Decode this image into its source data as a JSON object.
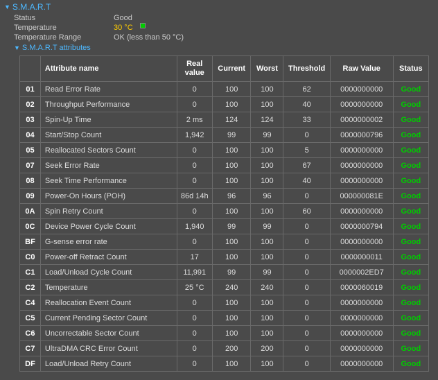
{
  "section": {
    "title": "S.M.A.R.T",
    "sub_title": "S.M.A.R.T attributes"
  },
  "info": {
    "status_label": "Status",
    "status_value": "Good",
    "temp_label": "Temperature",
    "temp_value": "30 °C",
    "range_label": "Temperature Range",
    "range_value": "OK (less than 50 °C)"
  },
  "headers": {
    "id": "",
    "name": "Attribute name",
    "real": "Real value",
    "current": "Current",
    "worst": "Worst",
    "threshold": "Threshold",
    "raw": "Raw Value",
    "status": "Status"
  },
  "rows": [
    {
      "id": "01",
      "name": "Read Error Rate",
      "real": "0",
      "current": "100",
      "worst": "100",
      "threshold": "62",
      "raw": "0000000000",
      "status": "Good"
    },
    {
      "id": "02",
      "name": "Throughput Performance",
      "real": "0",
      "current": "100",
      "worst": "100",
      "threshold": "40",
      "raw": "0000000000",
      "status": "Good"
    },
    {
      "id": "03",
      "name": "Spin-Up Time",
      "real": "2 ms",
      "current": "124",
      "worst": "124",
      "threshold": "33",
      "raw": "0000000002",
      "status": "Good"
    },
    {
      "id": "04",
      "name": "Start/Stop Count",
      "real": "1,942",
      "current": "99",
      "worst": "99",
      "threshold": "0",
      "raw": "0000000796",
      "status": "Good"
    },
    {
      "id": "05",
      "name": "Reallocated Sectors Count",
      "real": "0",
      "current": "100",
      "worst": "100",
      "threshold": "5",
      "raw": "0000000000",
      "status": "Good"
    },
    {
      "id": "07",
      "name": "Seek Error Rate",
      "real": "0",
      "current": "100",
      "worst": "100",
      "threshold": "67",
      "raw": "0000000000",
      "status": "Good"
    },
    {
      "id": "08",
      "name": "Seek Time Performance",
      "real": "0",
      "current": "100",
      "worst": "100",
      "threshold": "40",
      "raw": "0000000000",
      "status": "Good"
    },
    {
      "id": "09",
      "name": "Power-On Hours (POH)",
      "real": "86d 14h",
      "current": "96",
      "worst": "96",
      "threshold": "0",
      "raw": "000000081E",
      "status": "Good"
    },
    {
      "id": "0A",
      "name": "Spin Retry Count",
      "real": "0",
      "current": "100",
      "worst": "100",
      "threshold": "60",
      "raw": "0000000000",
      "status": "Good"
    },
    {
      "id": "0C",
      "name": "Device Power Cycle Count",
      "real": "1,940",
      "current": "99",
      "worst": "99",
      "threshold": "0",
      "raw": "0000000794",
      "status": "Good"
    },
    {
      "id": "BF",
      "name": "G-sense error rate",
      "real": "0",
      "current": "100",
      "worst": "100",
      "threshold": "0",
      "raw": "0000000000",
      "status": "Good"
    },
    {
      "id": "C0",
      "name": "Power-off Retract Count",
      "real": "17",
      "current": "100",
      "worst": "100",
      "threshold": "0",
      "raw": "0000000011",
      "status": "Good"
    },
    {
      "id": "C1",
      "name": "Load/Unload Cycle Count",
      "real": "11,991",
      "current": "99",
      "worst": "99",
      "threshold": "0",
      "raw": "0000002ED7",
      "status": "Good"
    },
    {
      "id": "C2",
      "name": "Temperature",
      "real": "25 °C",
      "current": "240",
      "worst": "240",
      "threshold": "0",
      "raw": "0000060019",
      "status": "Good"
    },
    {
      "id": "C4",
      "name": "Reallocation Event Count",
      "real": "0",
      "current": "100",
      "worst": "100",
      "threshold": "0",
      "raw": "0000000000",
      "status": "Good"
    },
    {
      "id": "C5",
      "name": "Current Pending Sector Count",
      "real": "0",
      "current": "100",
      "worst": "100",
      "threshold": "0",
      "raw": "0000000000",
      "status": "Good"
    },
    {
      "id": "C6",
      "name": "Uncorrectable Sector Count",
      "real": "0",
      "current": "100",
      "worst": "100",
      "threshold": "0",
      "raw": "0000000000",
      "status": "Good"
    },
    {
      "id": "C7",
      "name": "UltraDMA CRC Error Count",
      "real": "0",
      "current": "200",
      "worst": "200",
      "threshold": "0",
      "raw": "0000000000",
      "status": "Good"
    },
    {
      "id": "DF",
      "name": "Load/Unload Retry Count",
      "real": "0",
      "current": "100",
      "worst": "100",
      "threshold": "0",
      "raw": "0000000000",
      "status": "Good"
    }
  ]
}
